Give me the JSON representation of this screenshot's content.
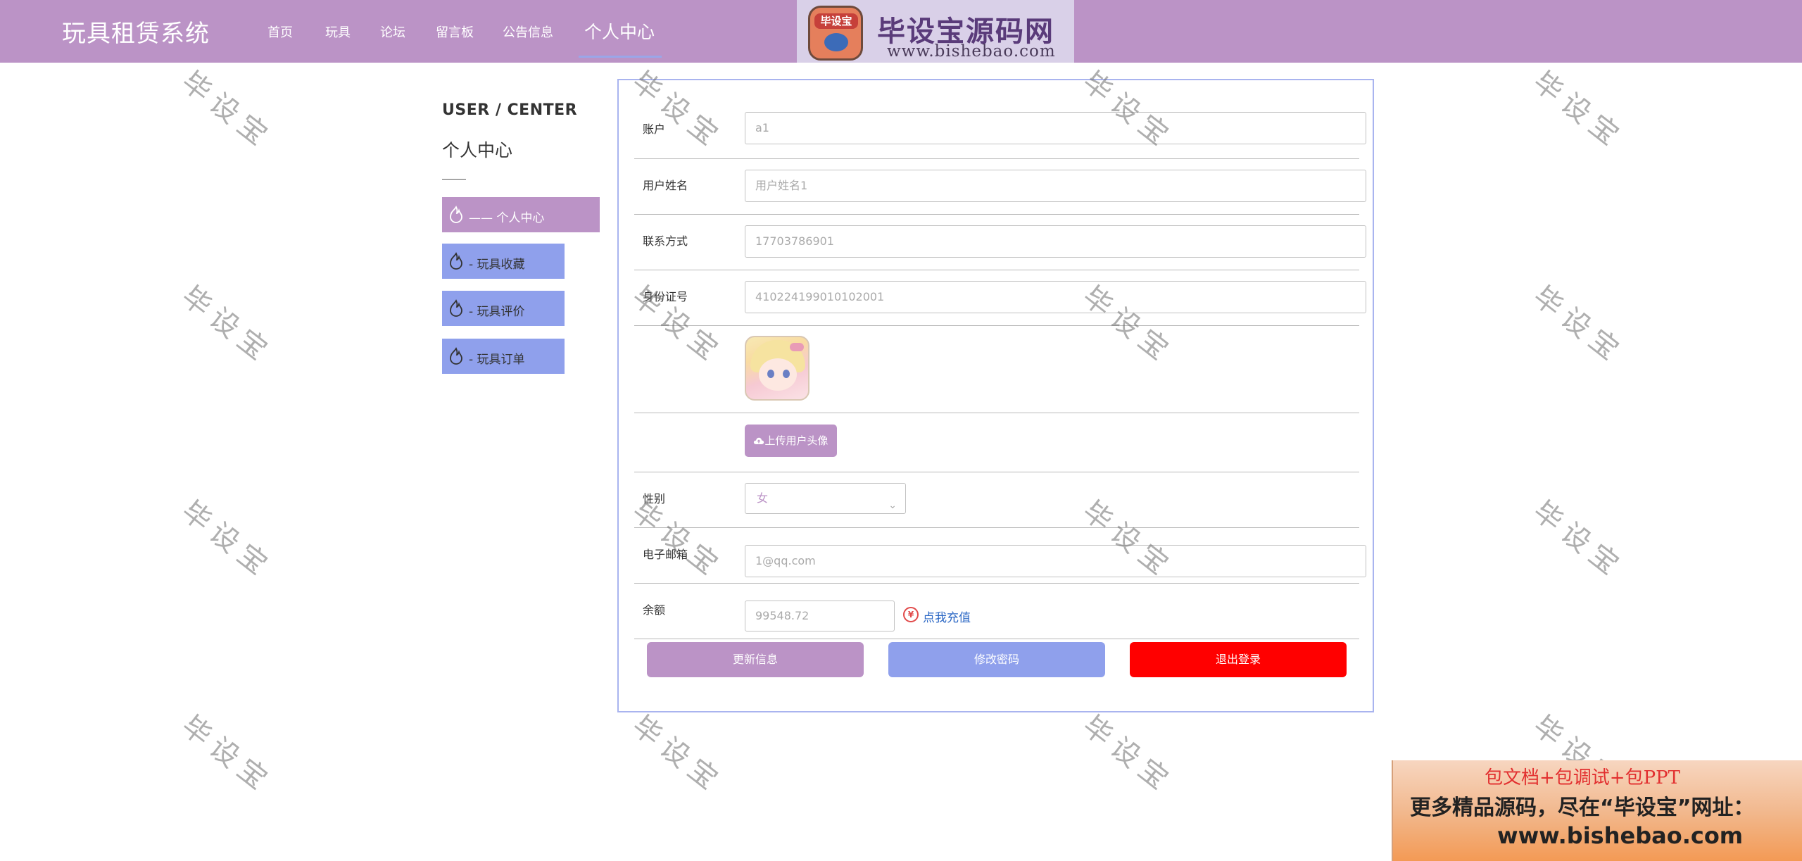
{
  "header": {
    "brand": "玩具租赁系统",
    "nav": [
      {
        "label": "首页"
      },
      {
        "label": "玩具"
      },
      {
        "label": "论坛"
      },
      {
        "label": "留言板"
      },
      {
        "label": "公告信息"
      },
      {
        "label": "个人中心",
        "active": true
      }
    ],
    "logo": {
      "badge": "毕设宝",
      "title": "毕设宝源码网",
      "url": "www.bishebao.com"
    }
  },
  "sidebar": {
    "title_en": "USER / CENTER",
    "title_cn": "个人中心",
    "items": [
      {
        "label": "——  个人中心",
        "active": true
      },
      {
        "label": "-  玩具收藏"
      },
      {
        "label": "-  玩具评价"
      },
      {
        "label": "-  玩具订单"
      }
    ]
  },
  "form": {
    "account": {
      "label": "账户",
      "value": "a1"
    },
    "username": {
      "label": "用户姓名",
      "value": "用户姓名1"
    },
    "phone": {
      "label": "联系方式",
      "value": "17703786901"
    },
    "idcard": {
      "label": "身份证号",
      "value": "410224199010102001"
    },
    "upload_label": "上传用户头像",
    "gender": {
      "label": "性别",
      "value": "女"
    },
    "email": {
      "label": "电子邮箱",
      "value": "1@qq.com"
    },
    "balance": {
      "label": "余额",
      "value": "99548.72",
      "recharge_icon": "¥",
      "recharge_label": "点我充值"
    },
    "actions": {
      "update": "更新信息",
      "password": "修改密码",
      "logout": "退出登录"
    }
  },
  "watermark": "毕设宝",
  "ad": {
    "line1": "包文档+包调试+包PPT",
    "line2": "更多精品源码，尽在“毕设宝”网址：",
    "line3": "www.bishebao.com"
  },
  "colors": {
    "primary": "#bb93c6",
    "secondary": "#8fa0ec",
    "danger": "#ff0000",
    "link": "#2c68c5"
  }
}
